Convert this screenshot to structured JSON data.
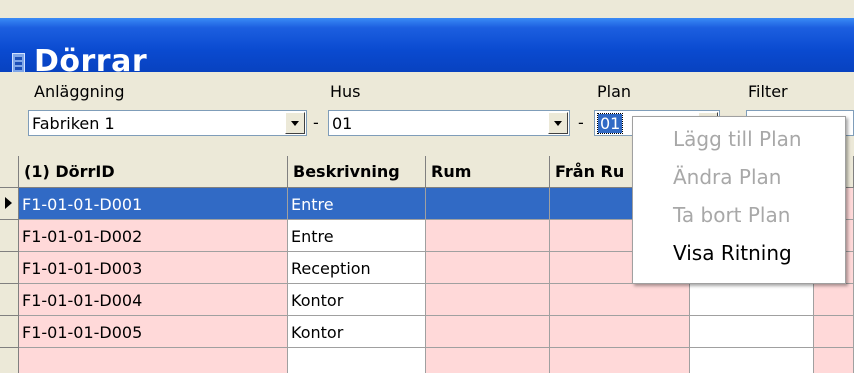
{
  "window": {
    "title": "Dörrar"
  },
  "filters": {
    "anlaggning": {
      "label": "Anläggning",
      "value": "Fabriken 1"
    },
    "hus": {
      "label": "Hus",
      "value": "01"
    },
    "plan": {
      "label": "Plan",
      "value": "01"
    },
    "filter": {
      "label": "Filter"
    },
    "separator": "-"
  },
  "table": {
    "columns": [
      "(1) DörrID",
      "Beskrivning",
      "Rum",
      "Från Ru"
    ],
    "rows": [
      {
        "id": "F1-01-01-D001",
        "desc": "Entre"
      },
      {
        "id": "F1-01-01-D002",
        "desc": "Entre"
      },
      {
        "id": "F1-01-01-D003",
        "desc": "Reception"
      },
      {
        "id": "F1-01-01-D004",
        "desc": "Kontor"
      },
      {
        "id": "F1-01-01-D005",
        "desc": "Kontor"
      }
    ],
    "selected_row": 0
  },
  "context_menu": {
    "items": [
      {
        "label": "Lägg till Plan",
        "enabled": false
      },
      {
        "label": "Ändra Plan",
        "enabled": false
      },
      {
        "label": "Ta bort Plan",
        "enabled": false
      },
      {
        "label": "Visa Ritning",
        "enabled": true
      }
    ]
  },
  "colors": {
    "title_bar": "#0a4ad0",
    "selection": "#316ac5",
    "row_tint": "#ffd9d9"
  }
}
